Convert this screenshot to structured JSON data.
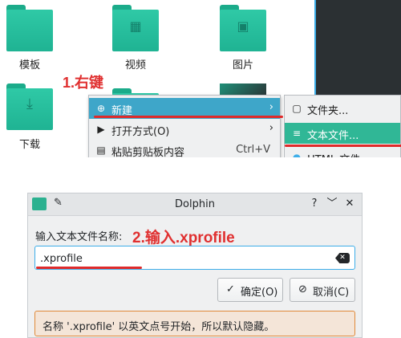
{
  "file_manager": {
    "folders": [
      {
        "label": "模板",
        "icon": "template-folder-icon"
      },
      {
        "label": "视频",
        "icon": "video-folder-icon"
      },
      {
        "label": "图片",
        "icon": "picture-folder-icon"
      },
      {
        "label": "下载",
        "icon": "download-folder-icon"
      }
    ],
    "annotation_1": "1.右键",
    "context_menu": {
      "items": [
        {
          "label": "新建",
          "icon": "new-icon",
          "arrow": "›"
        },
        {
          "label": "打开方式(O)",
          "icon": "open-with-icon",
          "arrow": "›"
        },
        {
          "label": "粘贴剪贴板内容",
          "icon": "paste-icon",
          "shortcut": "Ctrl+V"
        }
      ]
    },
    "submenu": {
      "items": [
        {
          "label": "文件夹...",
          "icon": "folder-icon"
        },
        {
          "label": "文本文件...",
          "icon": "text-file-icon"
        },
        {
          "label": "HTML 文件",
          "icon": "html-file-icon"
        }
      ]
    }
  },
  "dialog": {
    "title": "Dolphin",
    "titlebar_buttons": [
      "?",
      "﹀",
      "✕"
    ],
    "prompt": "输入文本文件名称:",
    "annotation_2": "2.输入.xprofile",
    "input_value": ".xprofile",
    "ok_label": "确定(O)",
    "cancel_label": "取消(C)",
    "warning": "名称 '.xprofile' 以英文点号开始，所以默认隐藏。"
  },
  "colors": {
    "annotation": "#e03030",
    "folder": "#2fc9a6",
    "menu_highlight": "#3ea6c9",
    "submenu_highlight": "#30b796",
    "warning_border": "#e08a3a"
  }
}
